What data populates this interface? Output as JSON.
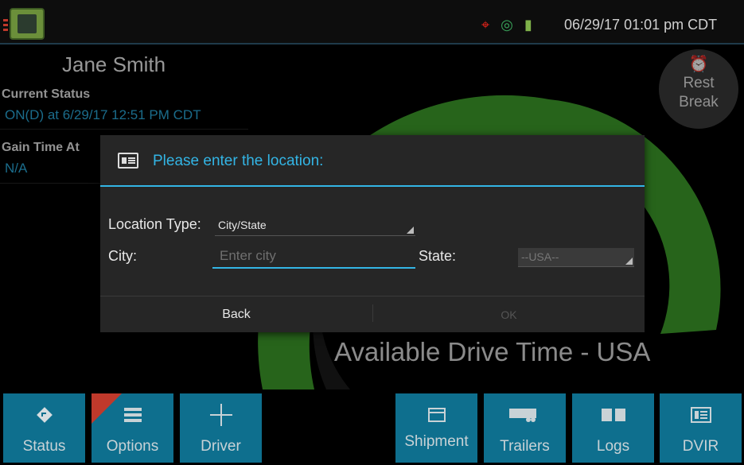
{
  "topbar": {
    "datetime": "06/29/17 01:01 pm CDT",
    "icons": [
      "app-logo-icon",
      "gps-error-icon",
      "connection-icon",
      "power-plug-icon"
    ],
    "colors": {
      "gps_error": "#e2231a",
      "connection": "#3aa55b",
      "power": "#7fb24a"
    }
  },
  "driver": {
    "name": "Jane Smith",
    "current_status_label": "Current Status",
    "current_status_value": "ON(D) at 6/29/17 12:51 PM CDT",
    "gain_time_label": "Gain Time At",
    "gain_time_value": "N/A"
  },
  "rest_break": {
    "line1": "Rest",
    "line2": "Break",
    "icon": "alarm-clock-icon"
  },
  "gauge": {
    "label": "Available Drive Time - USA",
    "color": "#3c9a2a"
  },
  "dialog": {
    "title": "Please enter the location:",
    "icon": "document-icon",
    "location_type_label": "Location Type:",
    "location_type_value": "City/State",
    "city_label": "City:",
    "city_value": "",
    "city_placeholder": "Enter city",
    "state_label": "State:",
    "state_value": "--USA--",
    "back_label": "Back",
    "ok_label": "OK",
    "accent": "#33b5e5"
  },
  "nav": [
    {
      "label": "Status",
      "icon": "direction-sign-icon"
    },
    {
      "label": "Options",
      "icon": "list-icon"
    },
    {
      "label": "Driver",
      "icon": "plus-icon"
    },
    {
      "label": "Shipment",
      "icon": "box-icon"
    },
    {
      "label": "Trailers",
      "icon": "trailer-icon"
    },
    {
      "label": "Logs",
      "icon": "book-icon"
    },
    {
      "label": "DVIR",
      "icon": "report-icon"
    }
  ],
  "nav_color": "#0e6f8e"
}
